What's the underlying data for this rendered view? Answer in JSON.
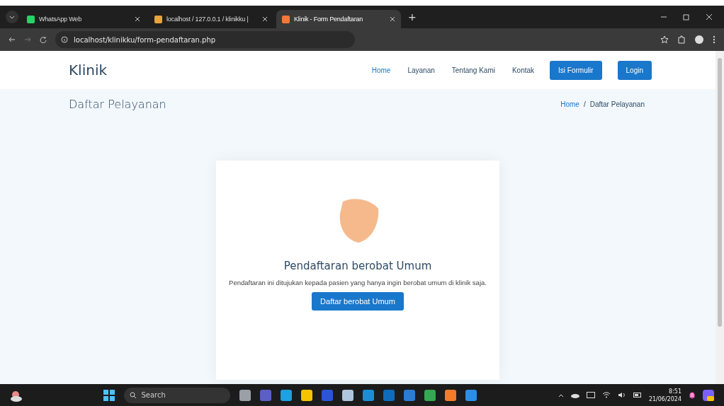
{
  "browser": {
    "tabs": [
      {
        "title": "WhatsApp Web",
        "selected": false,
        "color": "#25d366"
      },
      {
        "title": "localhost / 127.0.0.1 / klinikku |",
        "selected": false,
        "color": "#e8a33d"
      },
      {
        "title": "Klinik - Form Pendaftaran",
        "selected": true,
        "color": "#f0793a"
      }
    ],
    "new_tab": "+",
    "address": "localhost/klinikku/form-pendaftaran.php"
  },
  "site": {
    "brand": "Klinik",
    "nav": [
      {
        "label": "Home",
        "selected": true
      },
      {
        "label": "Layanan",
        "selected": false
      },
      {
        "label": "Tentang Kami",
        "selected": false
      },
      {
        "label": "Kontak",
        "selected": false
      }
    ],
    "buttons": [
      "Isi Formulir",
      "Login"
    ],
    "page_title": "Daftar Pelayanan",
    "breadcrumb": [
      "Home",
      "Daftar Pelayanan"
    ],
    "breadcrumb_separator": "/",
    "card": {
      "title": "Pendaftaran berobat Umum",
      "text": "Pendaftaran ini ditujukan kepada pasien yang hanya ingin berobat umum di klinik saja.",
      "button": "Daftar berobat Umum"
    }
  },
  "taskbar": {
    "search_placeholder": "Search",
    "apps": [
      {
        "color": "#9aa0a6"
      },
      {
        "color": "#5b5fc7"
      },
      {
        "color": "#1fa0e0"
      },
      {
        "color": "#f5c400"
      },
      {
        "color": "#2b55d6"
      },
      {
        "color": "#b0c4de"
      },
      {
        "color": "#1a8fd8"
      },
      {
        "color": "#0f6cbd"
      },
      {
        "color": "#2b7cd3"
      },
      {
        "color": "#34a853"
      },
      {
        "color": "#f47b2a"
      },
      {
        "color": "#2d8ee8"
      }
    ],
    "time": "8:51",
    "date": "21/06/2024"
  }
}
